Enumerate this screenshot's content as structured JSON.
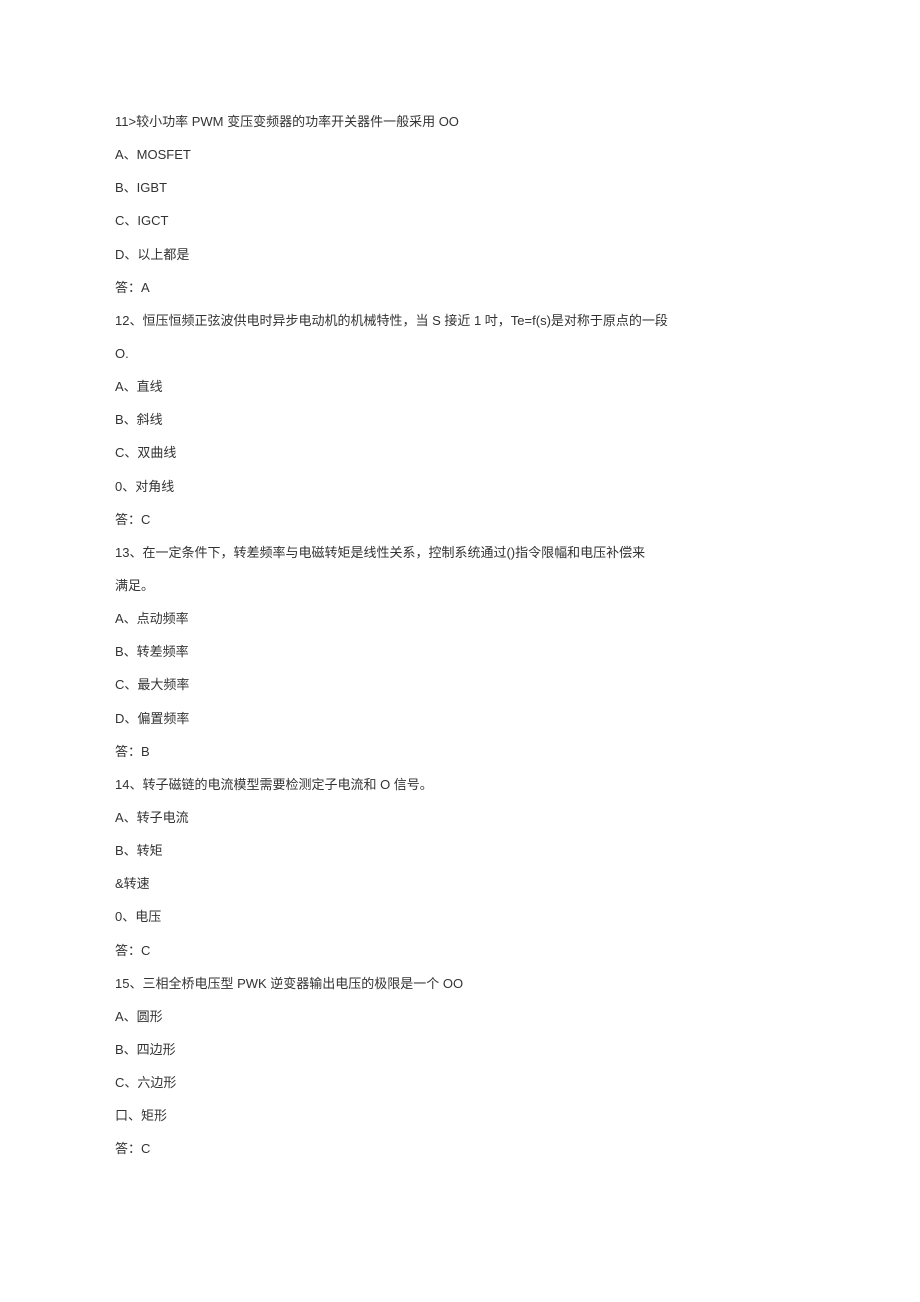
{
  "q11": {
    "stem": "11>较小功率 PWM 变压变频器的功率开关器件一般采用 OO",
    "a": "A、MOSFET",
    "b": "B、IGBT",
    "c": "C、IGCT",
    "d": "D、以上都是",
    "ans": "答：A"
  },
  "q12": {
    "stem1": "12、恒压恒频正弦波供电时异步电动机的机械特性，当 S 接近 1 吋，Te=f(s)是对称于原点的一段",
    "stem2": "O.",
    "a": "A、直线",
    "b": "B、斜线",
    "c": "C、双曲线",
    "d": "0、对角线",
    "ans": "答：C"
  },
  "q13": {
    "stem1": "13、在一定条件下，转差频率与电磁转矩是线性关系，控制系统通过()指令限幅和电压补偿来",
    "stem2": "满足。",
    "a": "A、点动频率",
    "b": "B、转差频率",
    "c": "C、最大频率",
    "d": "D、偏置频率",
    "ans": "答：B"
  },
  "q14": {
    "stem": "14、转子磁链的电流模型需要检测定子电流和 O 信号。",
    "a": "A、转子电流",
    "b": "B、转矩",
    "c": "&转速",
    "d": "0、电压",
    "ans": "答：C"
  },
  "q15": {
    "stem": "15、三相全桥电压型 PWK 逆变器输出电压的极限是一个 OO",
    "a": "A、圆形",
    "b": "B、四边形",
    "c": "C、六边形",
    "d": "口、矩形",
    "ans": "答：C"
  }
}
